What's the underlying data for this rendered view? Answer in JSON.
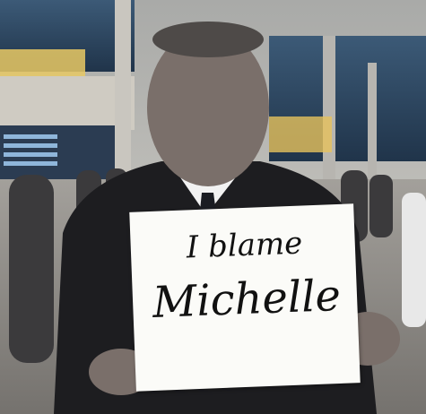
{
  "photo": {
    "setting": "airport-terminal",
    "sign": {
      "line1": "I blame",
      "line2": "Michelle"
    }
  },
  "colors": {
    "suit": "#1d1d20",
    "shirt": "#f2f2f2",
    "sign": "#fbfbf8",
    "floor": "#8e8a86",
    "ceiling": "#bcbcb8"
  }
}
